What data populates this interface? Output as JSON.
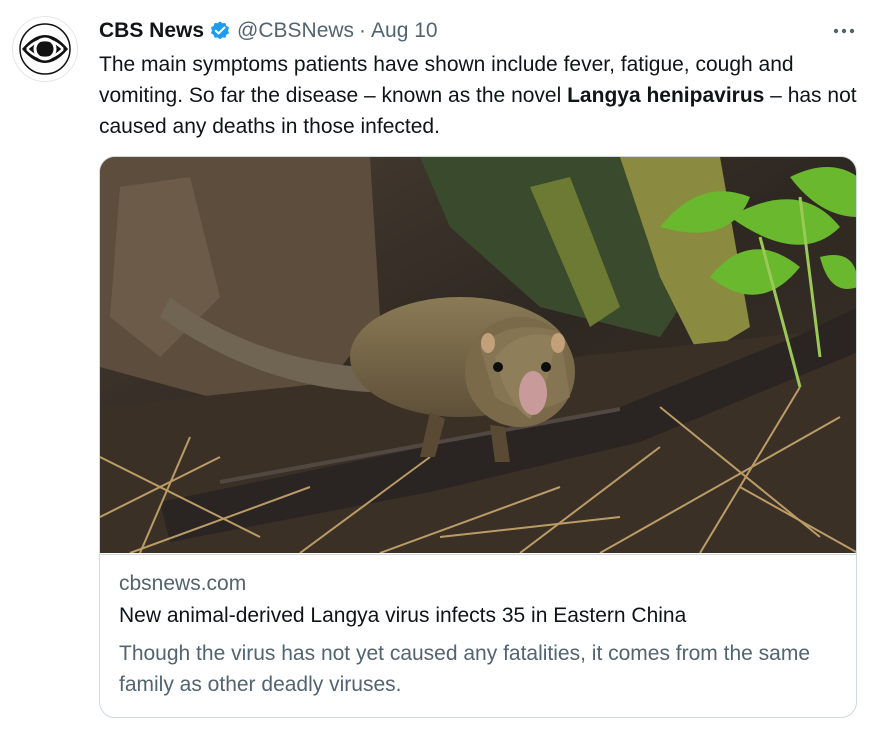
{
  "tweet": {
    "author_name": "CBS News",
    "handle": "@CBSNews",
    "separator": "·",
    "date": "Aug 10",
    "text_part1": "The main symptoms patients have shown include fever, fatigue, cough and vomiting. So far the disease – known as the novel ",
    "text_bold": "Langya henipavirus",
    "text_part2": " – has not caused any deaths in those infected."
  },
  "icons": {
    "avatar": "cbs-eye-logo",
    "verified": "verified-badge-icon",
    "more": "more-options-icon"
  },
  "link_card": {
    "domain": "cbsnews.com",
    "title": "New animal-derived Langya virus infects 35 in Eastern China",
    "description": "Though the virus has not yet caused any fatalities, it comes from the same family as other deadly viruses.",
    "image": "photo of a small rodent-like animal on a log"
  },
  "colors": {
    "verified_blue": "#1d9bf0",
    "text_primary": "#0f1419",
    "text_secondary": "#536471",
    "border": "#cfd9de"
  }
}
